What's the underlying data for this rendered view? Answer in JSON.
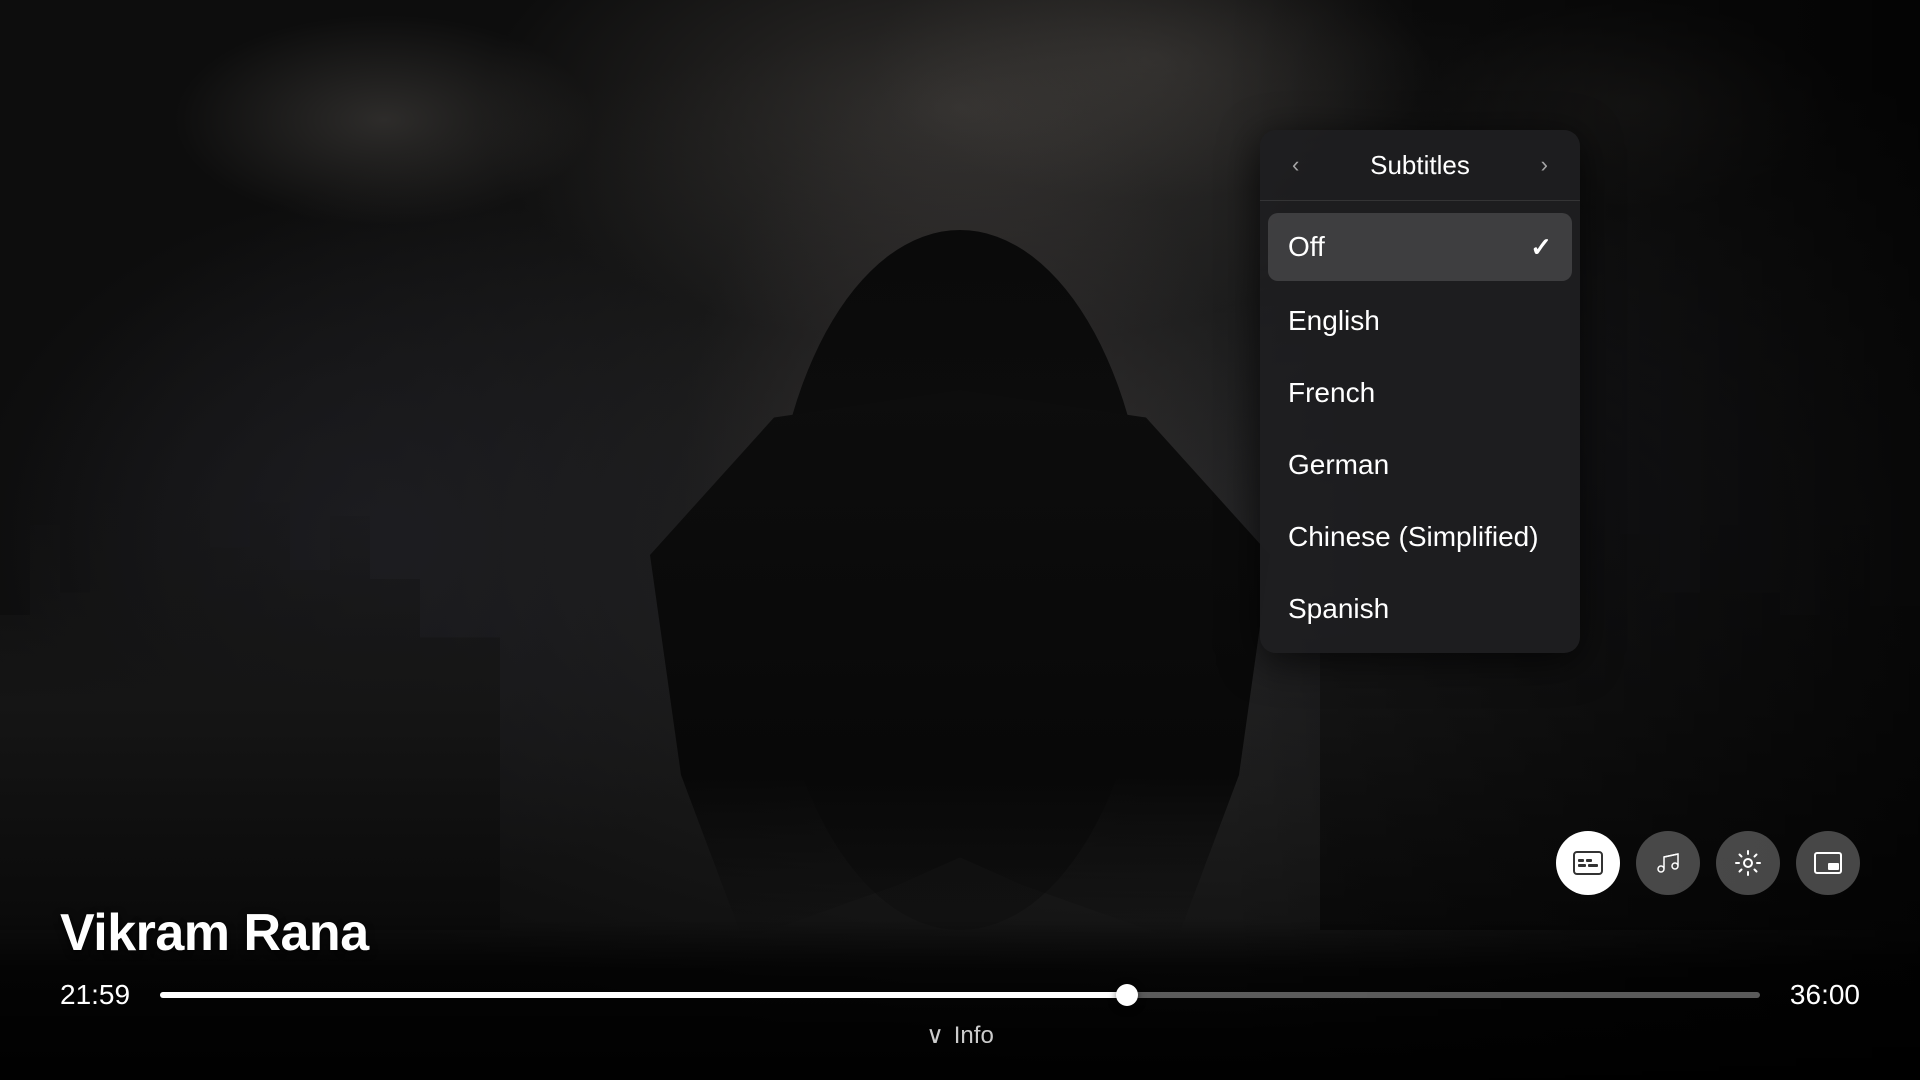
{
  "background": {
    "alt": "Superhero figure standing on rooftop overlooking cityscape with dramatic cloudy sky"
  },
  "movie": {
    "title": "Vikram Rana"
  },
  "player": {
    "current_time": "21:59",
    "total_time": "36:00",
    "progress_percent": 60.5
  },
  "subtitles_menu": {
    "title": "Subtitles",
    "items": [
      {
        "label": "Off",
        "selected": true
      },
      {
        "label": "English",
        "selected": false
      },
      {
        "label": "French",
        "selected": false
      },
      {
        "label": "German",
        "selected": false
      },
      {
        "label": "Chinese (Simplified)",
        "selected": false
      },
      {
        "label": "Spanish",
        "selected": false
      }
    ],
    "prev_label": "‹",
    "next_label": "›"
  },
  "controls": {
    "subtitles_label": "CC",
    "audio_label": "♪",
    "settings_label": "⚙",
    "pip_label": "⧉"
  },
  "info_bar": {
    "chevron": "∨",
    "label": "Info"
  }
}
